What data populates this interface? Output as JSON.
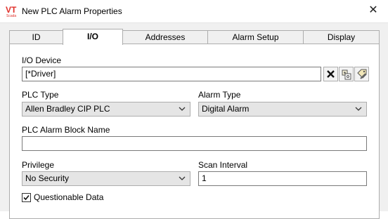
{
  "window": {
    "title": "New PLC Alarm Properties",
    "logo_text": "VT",
    "logo_subtext": "Scada"
  },
  "tabs": [
    {
      "label": "ID",
      "active": false
    },
    {
      "label": "I/O",
      "active": true
    },
    {
      "label": "Addresses",
      "active": false
    },
    {
      "label": "Alarm Setup",
      "active": false
    },
    {
      "label": "Display",
      "active": false
    }
  ],
  "io_device": {
    "label": "I/O Device",
    "value": "[*Driver]"
  },
  "plc_type": {
    "label": "PLC Type",
    "value": "Allen Bradley CIP PLC"
  },
  "alarm_type": {
    "label": "Alarm Type",
    "value": "Digital Alarm"
  },
  "plc_alarm_block_name": {
    "label": "PLC Alarm Block Name",
    "value": ""
  },
  "privilege": {
    "label": "Privilege",
    "value": "No Security"
  },
  "scan_interval": {
    "label": "Scan Interval",
    "value": "1"
  },
  "questionable_data": {
    "label": "Questionable Data",
    "checked": true
  },
  "icons": {
    "clear": "clear-x-icon",
    "browse": "tag-browse-icon",
    "edit": "tag-edit-icon",
    "close": "close-icon",
    "dropdown": "chevron-down-icon",
    "check": "checkmark-icon"
  },
  "colors": {
    "logo_red": "#e0312b",
    "dialog_bg": "#f0f0f0",
    "combo_bg": "#e5e5e5"
  }
}
